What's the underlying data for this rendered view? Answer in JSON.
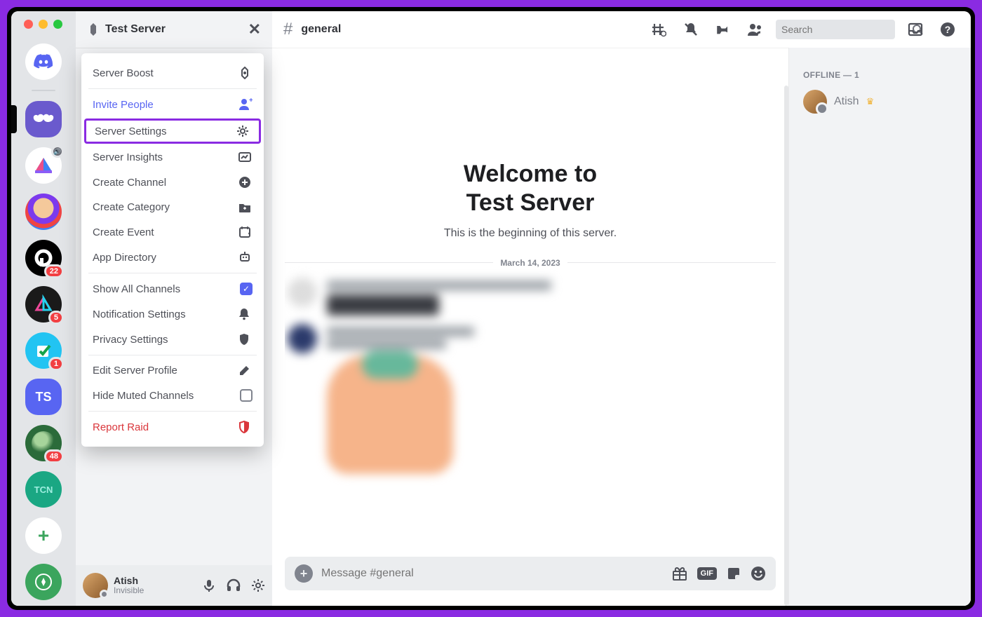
{
  "server_title": "Test Server",
  "channel": {
    "name": "general",
    "hash": "#"
  },
  "search_placeholder": "Search",
  "dropdown": {
    "boost": "Server Boost",
    "invite": "Invite People",
    "settings": "Server Settings",
    "insights": "Server Insights",
    "create_channel": "Create Channel",
    "create_category": "Create Category",
    "create_event": "Create Event",
    "app_directory": "App Directory",
    "show_all": "Show All Channels",
    "notif": "Notification Settings",
    "privacy": "Privacy Settings",
    "edit_profile": "Edit Server Profile",
    "hide_muted": "Hide Muted Channels",
    "report_raid": "Report Raid"
  },
  "welcome": {
    "line1": "Welcome to",
    "line2": "Test Server",
    "sub": "This is the beginning of this server.",
    "date": "March 14, 2023"
  },
  "composer_placeholder": "Message #general",
  "members": {
    "offline_header": "OFFLINE — 1",
    "user1": "Atish"
  },
  "user_panel": {
    "name": "Atish",
    "status": "Invisible"
  },
  "rail": {
    "ts_label": "TS",
    "badges": {
      "p": "22",
      "tri": "5",
      "chk": "1",
      "grn": "48"
    },
    "add": "+"
  }
}
